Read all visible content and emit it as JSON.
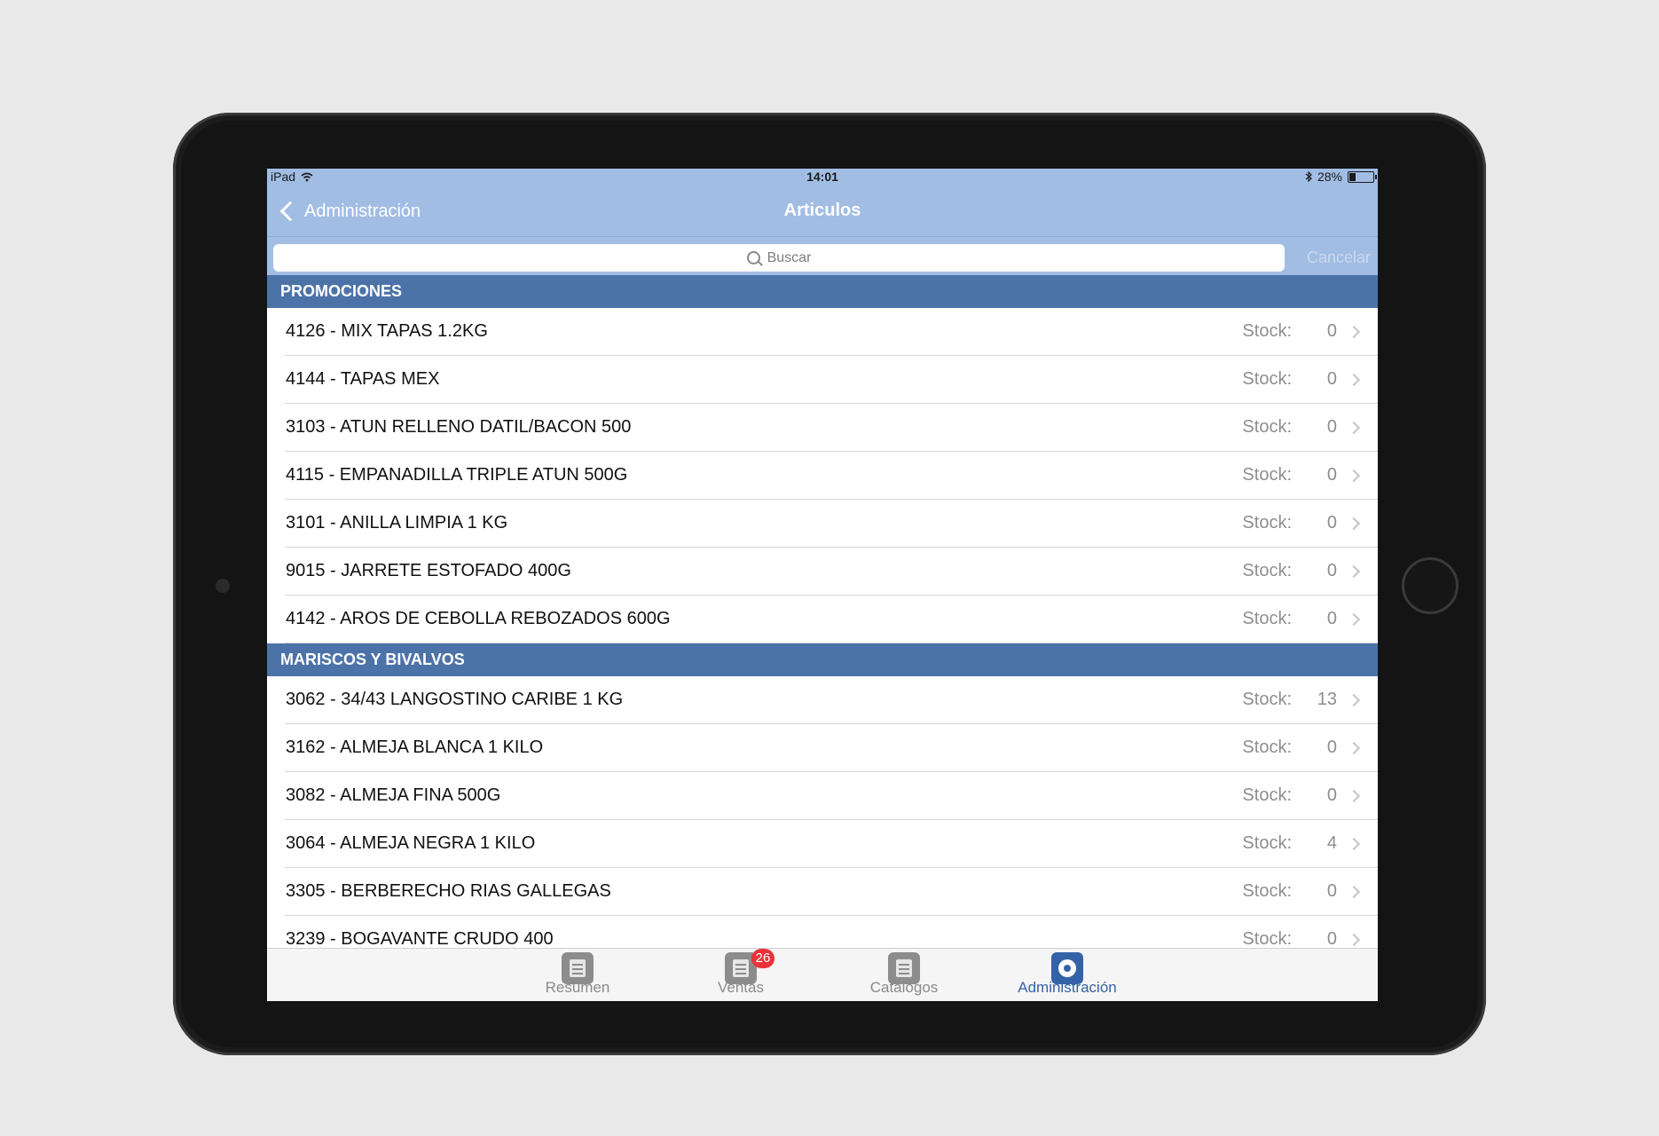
{
  "status": {
    "device": "iPad",
    "time": "14:01",
    "battery": "28%"
  },
  "nav": {
    "back_label": "Administración",
    "title": "Articulos"
  },
  "search": {
    "placeholder": "Buscar",
    "cancel_label": "Cancelar"
  },
  "sections": [
    {
      "title": "PROMOCIONES",
      "items": [
        {
          "name": "4126 - MIX TAPAS 1.2KG",
          "stock_label": "Stock:",
          "stock": "0"
        },
        {
          "name": "4144 - TAPAS MEX",
          "stock_label": "Stock:",
          "stock": "0"
        },
        {
          "name": "3103 - ATUN RELLENO DATIL/BACON 500",
          "stock_label": "Stock:",
          "stock": "0"
        },
        {
          "name": "4115 - EMPANADILLA TRIPLE ATUN 500G",
          "stock_label": "Stock:",
          "stock": "0"
        },
        {
          "name": "3101 - ANILLA LIMPIA 1 KG",
          "stock_label": "Stock:",
          "stock": "0"
        },
        {
          "name": "9015 - JARRETE ESTOFADO 400G",
          "stock_label": "Stock:",
          "stock": "0"
        },
        {
          "name": "4142 - AROS DE CEBOLLA REBOZADOS 600G",
          "stock_label": "Stock:",
          "stock": "0"
        }
      ]
    },
    {
      "title": "MARISCOS Y BIVALVOS",
      "items": [
        {
          "name": "3062 - 34/43 LANGOSTINO CARIBE 1 KG",
          "stock_label": "Stock:",
          "stock": "13"
        },
        {
          "name": "3162 - ALMEJA BLANCA 1 KILO",
          "stock_label": "Stock:",
          "stock": "0"
        },
        {
          "name": "3082 - ALMEJA FINA 500G",
          "stock_label": "Stock:",
          "stock": "0"
        },
        {
          "name": "3064 - ALMEJA NEGRA 1 KILO",
          "stock_label": "Stock:",
          "stock": "4"
        },
        {
          "name": "3305 - BERBERECHO RIAS GALLEGAS",
          "stock_label": "Stock:",
          "stock": "0"
        },
        {
          "name": "3239 - BOGAVANTE CRUDO 400",
          "stock_label": "Stock:",
          "stock": "0"
        }
      ]
    }
  ],
  "tabs": [
    {
      "label": "Resumen",
      "icon": "document-icon",
      "active": false
    },
    {
      "label": "Ventas",
      "icon": "sales-icon",
      "badge": "26",
      "active": false
    },
    {
      "label": "Catalogos",
      "icon": "catalog-icon",
      "active": false
    },
    {
      "label": "Administración",
      "icon": "gear-icon",
      "active": true
    }
  ],
  "colors": {
    "navbar": "#a1bde4",
    "section_header": "#4c73a8",
    "active_tab": "#3462a8",
    "badge": "#e8333a"
  }
}
